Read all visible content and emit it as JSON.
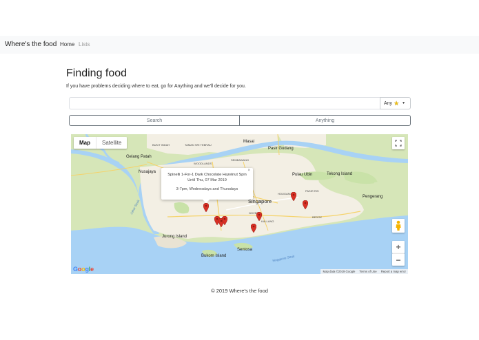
{
  "navbar": {
    "brand": "Where's the food",
    "links": [
      {
        "label": "Home",
        "active": true
      },
      {
        "label": "Lists",
        "active": false
      }
    ]
  },
  "header": {
    "title": "Finding food",
    "subtitle": "If you have problems deciding where to eat, go for Anything and we'll decide for you."
  },
  "search": {
    "value": "",
    "placeholder": "",
    "rating_filter": {
      "label": "Any",
      "icon": "star-icon"
    }
  },
  "buttons": {
    "search_label": "Search",
    "anything_label": "Anything"
  },
  "map": {
    "type_options": [
      {
        "label": "Map",
        "selected": true
      },
      {
        "label": "Satellite",
        "selected": false
      }
    ],
    "info_window": {
      "title": "Spinelli 1-For-1 Dark Chocolate Hazelnut Spin",
      "date": "Until Thu, 07 Mar 2019",
      "hours": "3-7pm, Wednesdays and Thursdays",
      "close": "×"
    },
    "labels": {
      "singapore": "Singapore",
      "pasir_gudang": "Pasir Gudang",
      "masai": "Masai",
      "pulau_ubin": "Pulau Ubin",
      "tekong": "Tekong Island",
      "pengerang": "Pengerang",
      "jurong": "Jurong Island",
      "bukom": "Bukom Island",
      "sentosa": "Sentosa",
      "gelang_patah": "Gelang Patah",
      "nusajaya": "Nusajaya",
      "bukit_indah": "BUKIT INDAH",
      "johor_strait": "Johor Strait",
      "singapore_strait": "Singapore Strait",
      "taman_sri_tebrau": "TAMAN SRI TEBRAU",
      "sembawang": "SEMBAWANG",
      "woodlands": "WOODLANDS",
      "pasir_ris": "PASIR RIS",
      "bedok": "BEDOK",
      "novena": "NOVENA",
      "hougang": "HOUGANG",
      "kallang": "KALLANG"
    },
    "google_logo": "Google",
    "attribution": {
      "map_data": "Map data ©2019 Google",
      "terms": "Terms of Use",
      "report": "Report a map error"
    },
    "colors": {
      "land": "#d6e6b8",
      "urban": "#f3efe4",
      "water": "#a8d2f5",
      "pin": "#d93025"
    }
  },
  "footer": {
    "text": "© 2019 Where's the food"
  }
}
